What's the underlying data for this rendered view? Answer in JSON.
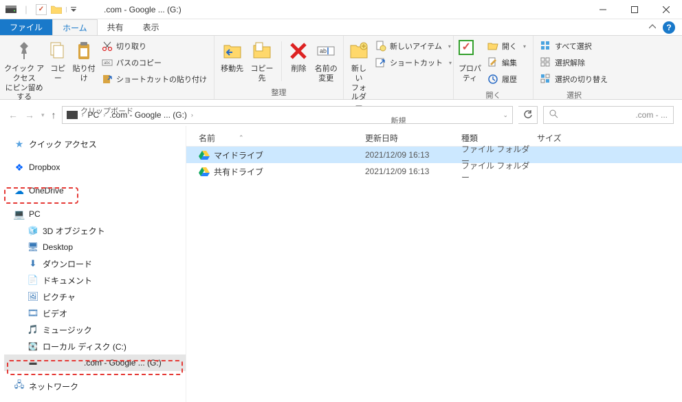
{
  "window": {
    "title": ".com - Google ... (G:)"
  },
  "tabs": {
    "file": "ファイル",
    "home": "ホーム",
    "share": "共有",
    "view": "表示"
  },
  "ribbon": {
    "clipboard": {
      "pin": "クイック アクセス\nにピン留めする",
      "copy": "コピー",
      "paste": "貼り付け",
      "cut": "切り取り",
      "copy_path": "パスのコピー",
      "paste_shortcut": "ショートカットの貼り付け",
      "group": "クリップボード"
    },
    "organize": {
      "moveto": "移動先",
      "copyto": "コピー先",
      "delete": "削除",
      "rename": "名前の\n変更",
      "group": "整理"
    },
    "new": {
      "newfolder": "新しい\nフォルダー",
      "newitem": "新しいアイテム",
      "shortcut": "ショートカット",
      "group": "新規"
    },
    "open": {
      "properties": "プロパ\nティ",
      "open": "開く",
      "edit": "編集",
      "history": "履歴",
      "group": "開く"
    },
    "select": {
      "select_all": "すべて選択",
      "select_none": "選択解除",
      "select_invert": "選択の切り替え",
      "group": "選択"
    }
  },
  "breadcrumb": {
    "pc": "PC",
    "drive": ".com - Google ... (G:)"
  },
  "search": {
    "placeholder": ".com - ..."
  },
  "sidebar": {
    "quick_access": "クイック アクセス",
    "dropbox": "Dropbox",
    "onedrive": "OneDrive",
    "pc": "PC",
    "objects3d": "3D オブジェクト",
    "desktop": "Desktop",
    "downloads": "ダウンロード",
    "documents": "ドキュメント",
    "pictures": "ピクチャ",
    "videos": "ビデオ",
    "music": "ミュージック",
    "local_disk": "ローカル ディスク (C:)",
    "gdrive": ".com - Google ... (G:)",
    "network": "ネットワーク"
  },
  "columns": {
    "name": "名前",
    "date": "更新日時",
    "type": "種類",
    "size": "サイズ"
  },
  "rows": [
    {
      "name": "マイドライブ",
      "date": "2021/12/09 16:13",
      "type": "ファイル フォルダー"
    },
    {
      "name": "共有ドライブ",
      "date": "2021/12/09 16:13",
      "type": "ファイル フォルダー"
    }
  ]
}
